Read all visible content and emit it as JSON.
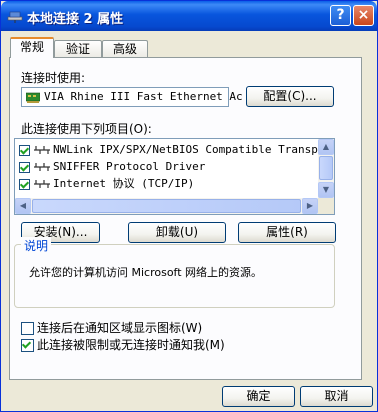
{
  "window": {
    "title": "本地连接 2 属性",
    "help_button": "?",
    "close_button": "×"
  },
  "tabs": [
    {
      "label": "常规",
      "active": true
    },
    {
      "label": "验证",
      "active": false
    },
    {
      "label": "高级",
      "active": false
    }
  ],
  "connect_using": {
    "label": "连接时使用:",
    "adapter": "VIA Rhine III Fast Ethernet Ac",
    "configure_button": "配置(C)..."
  },
  "components": {
    "label": "此连接使用下列项目(O):",
    "items": [
      {
        "label": "NWLink IPX/SPX/NetBIOS Compatible Transpor.",
        "checked": true
      },
      {
        "label": "SNIFFER Protocol Driver",
        "checked": true
      },
      {
        "label": "Internet 协议 (TCP/IP)",
        "checked": true
      }
    ],
    "scroll_up": "▲",
    "scroll_down": "▼",
    "scroll_left": "◀",
    "scroll_right": "▶"
  },
  "actions": {
    "install": "安装(N)...",
    "uninstall": "卸载(U)",
    "properties": "属性(R)"
  },
  "description": {
    "legend": "说明",
    "text": "允许您的计算机访问 Microsoft 网络上的资源。"
  },
  "options": [
    {
      "label": "连接后在通知区域显示图标(W)",
      "checked": false
    },
    {
      "label": "此连接被限制或无连接时通知我(M)",
      "checked": true
    }
  ],
  "footer": {
    "ok": "确定",
    "cancel": "取消"
  },
  "colors": {
    "titlebar": "#0855dd",
    "accent_tab": "#e68b2c",
    "legend_text": "#0046d5",
    "check": "#21a121"
  }
}
